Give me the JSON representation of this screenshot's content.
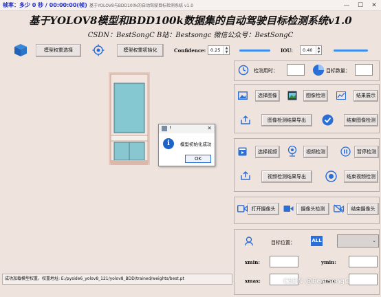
{
  "window": {
    "overlay_stats": "帧率：多少 0 秒 / 00:00:00(帧)",
    "title": "基于YOLOV8与BDD100k的自动驾驶目标检测系统 v1.0",
    "min_label": "—",
    "max_label": "☐",
    "close_label": "✕"
  },
  "header": {
    "title": "基于YOLOV8模型和BDD100k数据集的自动驾驶目标检测系统v1.0",
    "subtitle": "CSDN：BestSongC   B站：Bestsongc   微信公众号：BestSongC"
  },
  "toolbar": {
    "select_weights": "模型权重选择",
    "init_weights": "模型权重初始化",
    "confidence_label": "Confidence:",
    "confidence_value": "0.25",
    "iou_label": "IOU:",
    "iou_value": "0.40",
    "confidence_fraction": 0.25,
    "iou_fraction": 0.4
  },
  "stats": {
    "time_label": "检测用时：",
    "time_value": "",
    "count_label": "目标数量：",
    "count_value": ""
  },
  "image_panel": {
    "select": "选择图像",
    "detect": "图像检测",
    "show": "结果展示",
    "export": "图像检测结果导出",
    "end": "结束图像检测"
  },
  "video_panel": {
    "select": "选择视频",
    "detect": "视频检测",
    "pause": "暂停检测",
    "export": "视频检测结果导出",
    "end": "结束视频检测"
  },
  "camera_panel": {
    "open": "打开摄像头",
    "detect": "摄像头检测",
    "close": "结束摄像头"
  },
  "target_panel": {
    "position_label": "目标位置：",
    "all_label": "ALL",
    "xmin": "xmin:",
    "ymin": "ymin:",
    "xmax": "xmax:",
    "ymax": "ymax:"
  },
  "dialog": {
    "title": "!",
    "message": "模型初始化成功",
    "ok": "OK",
    "close": "✕"
  },
  "status": {
    "text": "成功加载模型权重，权重地址: E:/pyside6_yolov8_121/yolov8_BDD/trained/weights/best.pt"
  },
  "watermark": "CSDN @BestSongC",
  "colors": {
    "background": "#efe3de",
    "accent": "#2a6fd8",
    "slider": "#3d8ee8"
  }
}
